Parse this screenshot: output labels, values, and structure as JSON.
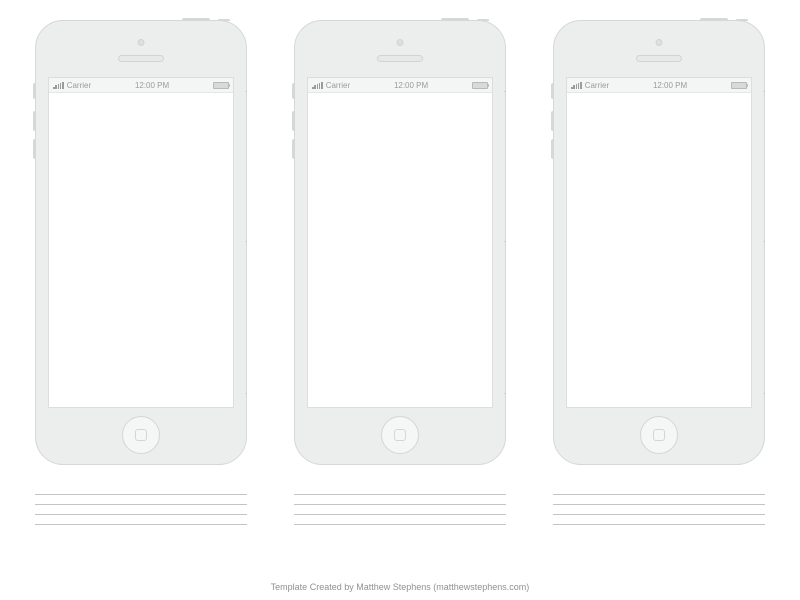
{
  "statusbar": {
    "carrier": "Carrier",
    "time": "12:00 PM"
  },
  "credit": "Template Created by Matthew Stephens (matthewstephens.com)",
  "phone_count": 3,
  "note_lines": 4
}
